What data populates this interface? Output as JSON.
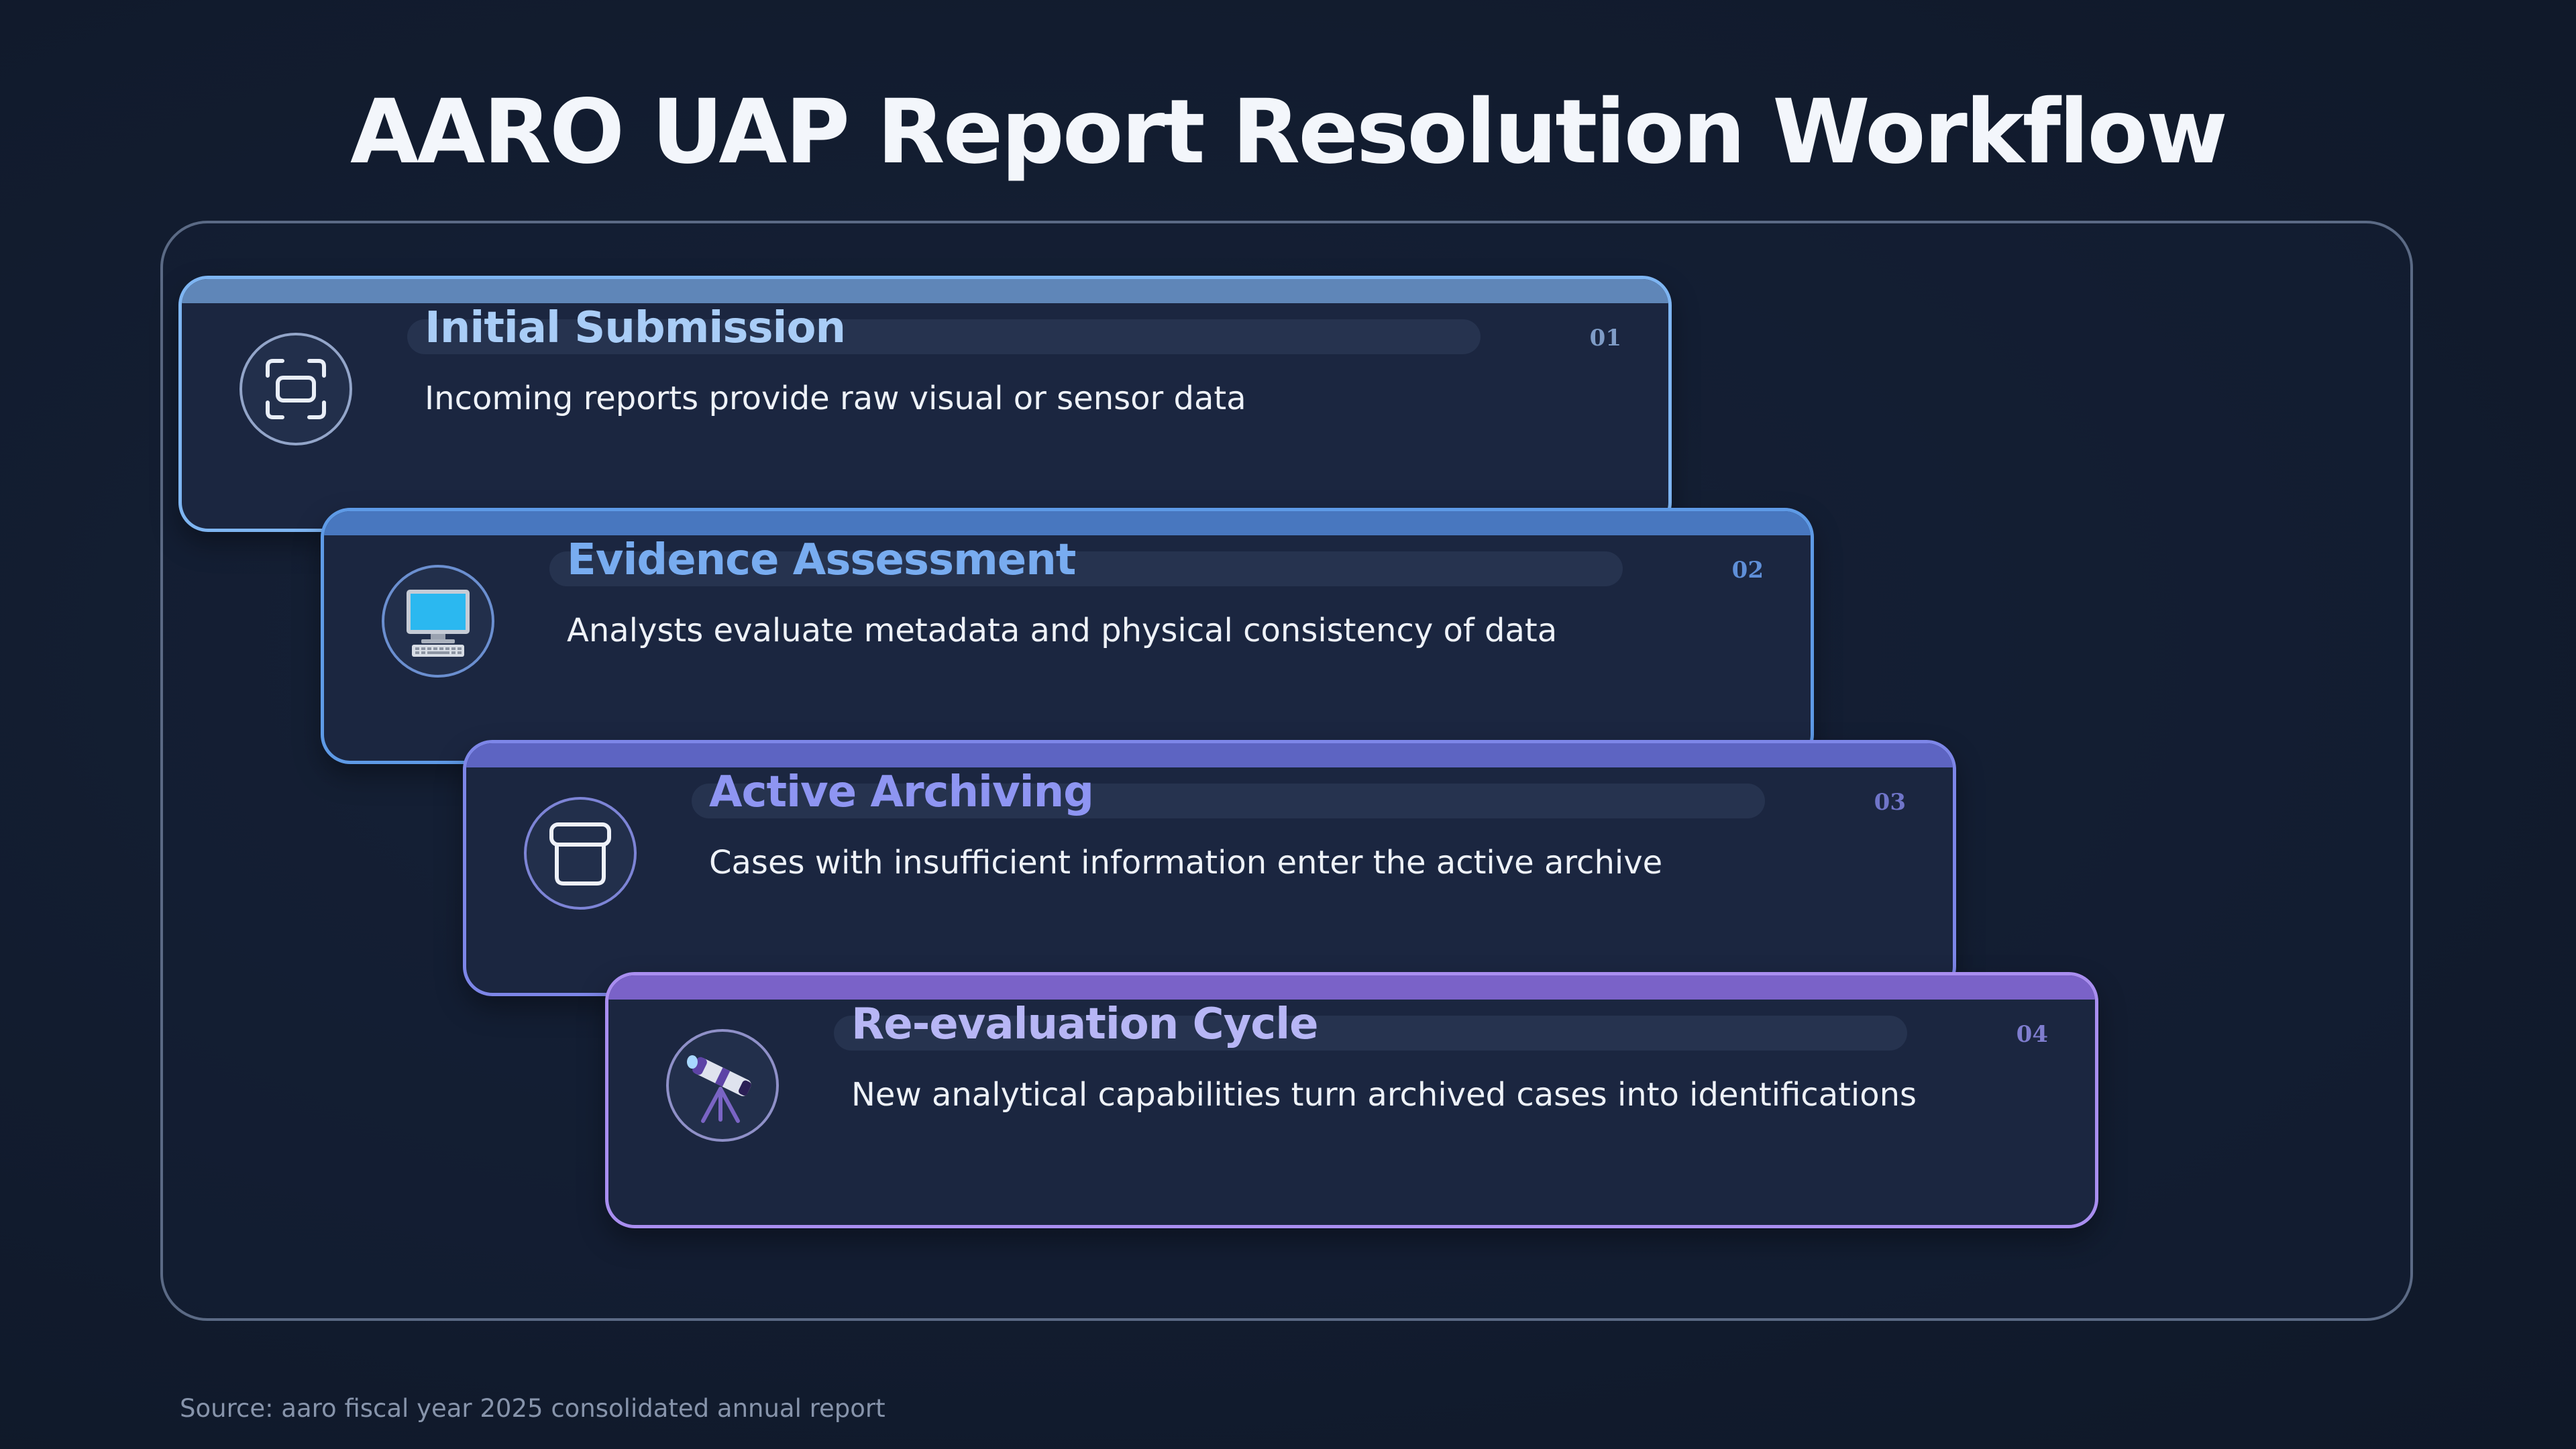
{
  "title": "AARO UAP Report Resolution Workflow",
  "source": "Source: aaro fiscal year 2025 consolidated annual report",
  "steps": [
    {
      "number": "01",
      "title": "Initial Submission",
      "description": "Incoming reports provide raw visual or sensor data",
      "icon": "capture-frame-icon",
      "accent": "#7eb5f2",
      "bar": "#5f86b8",
      "title_color": "#a9cdf7"
    },
    {
      "number": "02",
      "title": "Evidence Assessment",
      "description": "Analysts evaluate metadata and physical consistency of data",
      "icon": "desktop-computer-icon",
      "accent": "#5e9ae6",
      "bar": "#4877bf",
      "title_color": "#78acf0"
    },
    {
      "number": "03",
      "title": "Active Archiving",
      "description": "Cases with insufficient information enter the active archive",
      "icon": "archive-box-icon",
      "accent": "#7d86e8",
      "bar": "#5d64c2",
      "title_color": "#8e95f2"
    },
    {
      "number": "04",
      "title": "Re-evaluation Cycle",
      "description": "New analytical capabilities turn archived cases into identifications",
      "icon": "telescope-icon",
      "accent": "#a98ef0",
      "bar": "#7a62c8",
      "title_color": "#b7b6f5"
    }
  ]
}
